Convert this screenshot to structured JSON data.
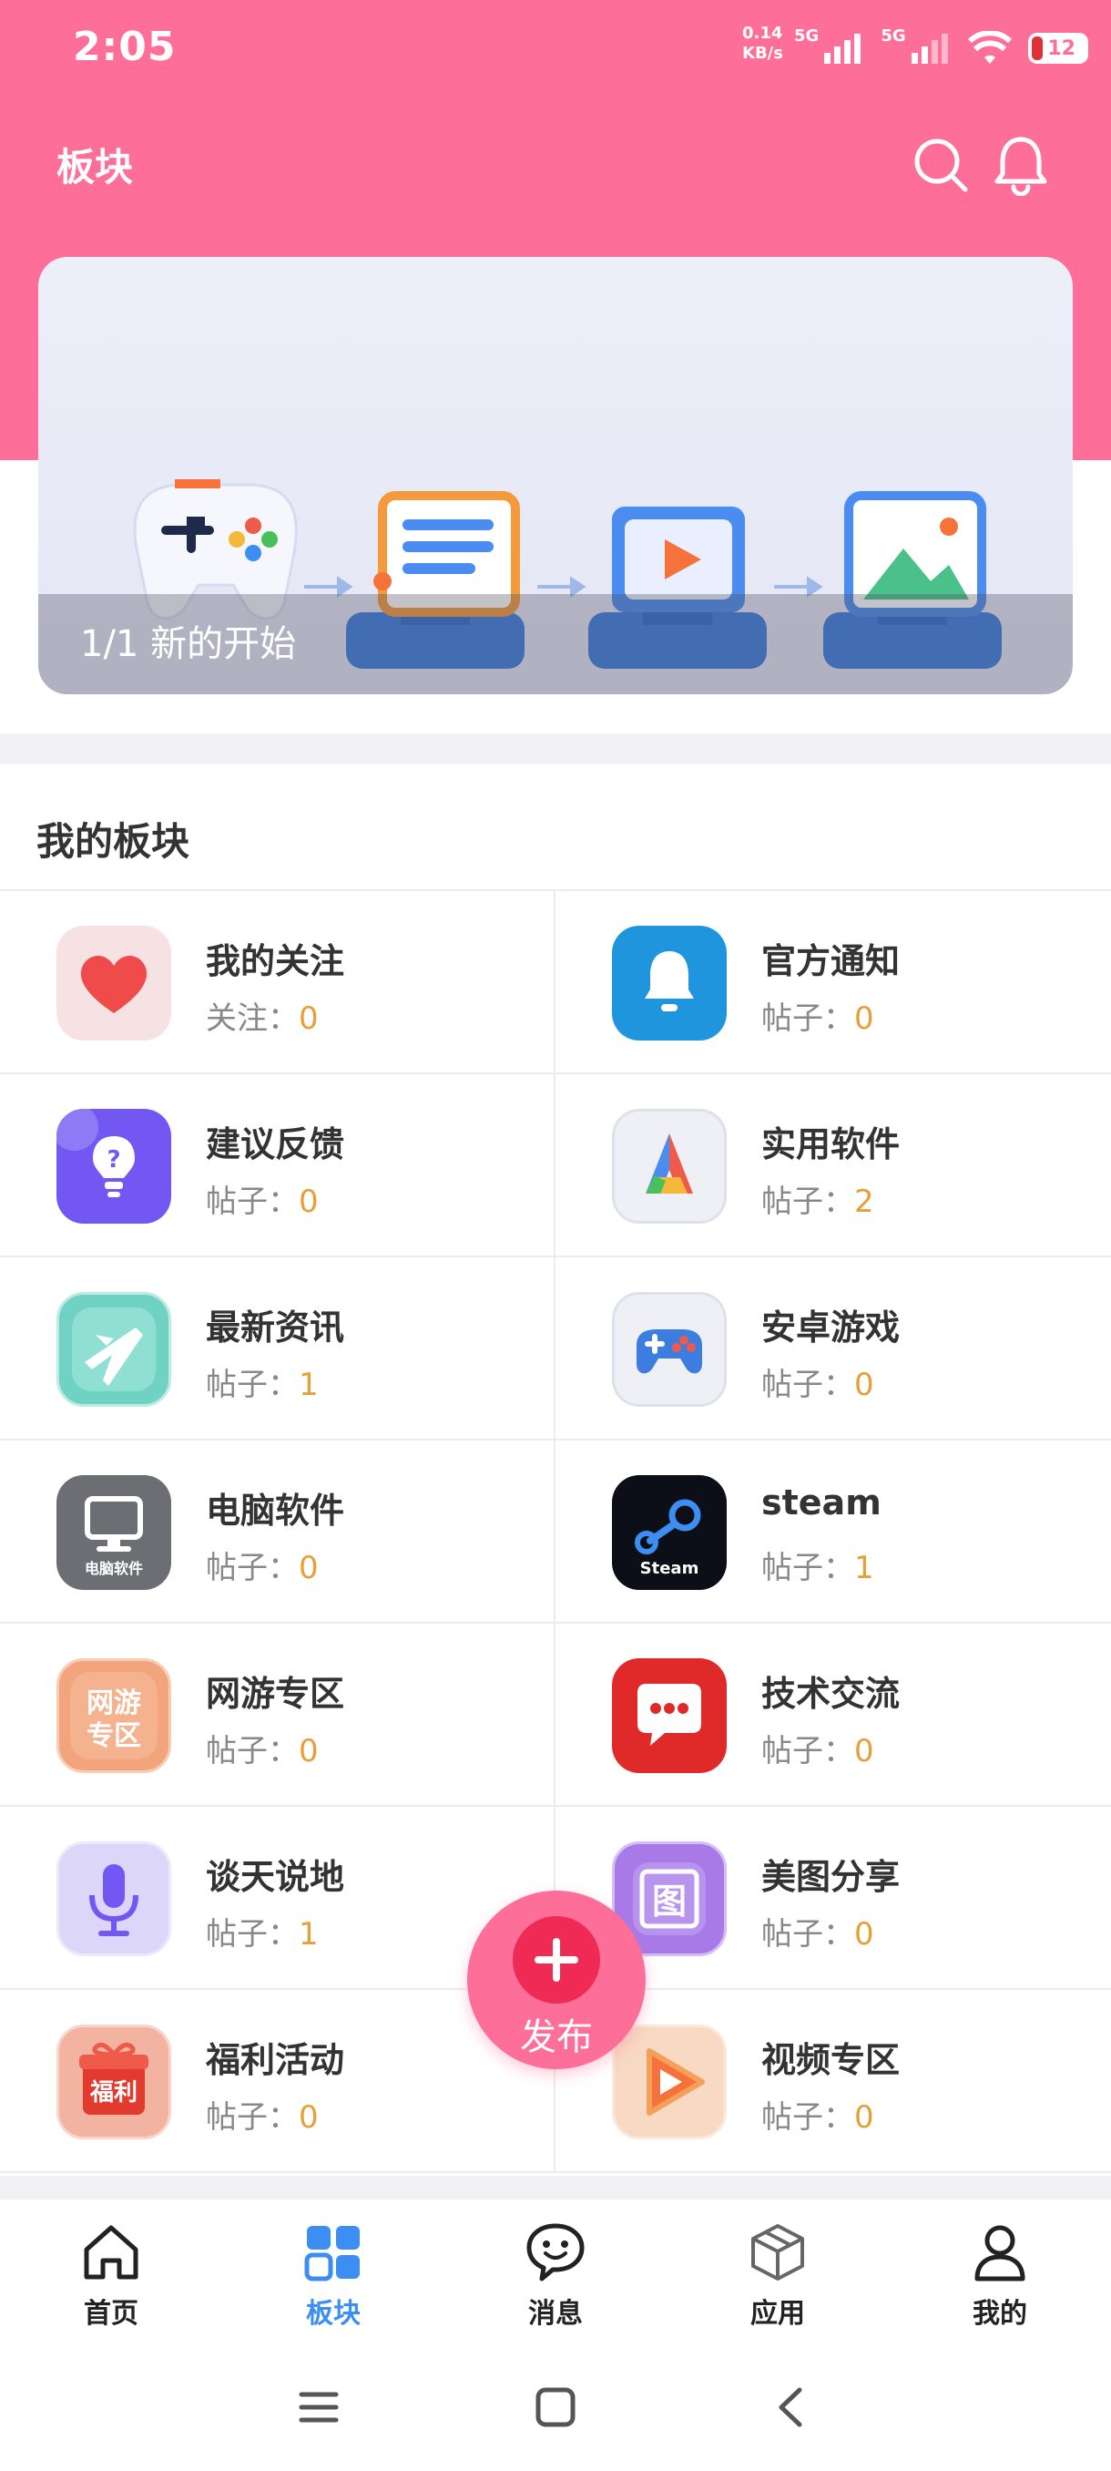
{
  "status_bar": {
    "time": "2:05",
    "speed_value": "0.14",
    "speed_unit": "KB/s",
    "network_1": "5G",
    "network_2": "5G",
    "battery": "12"
  },
  "header": {
    "title": "板块",
    "search_icon": "search-icon",
    "bell_icon": "bell-icon"
  },
  "banner": {
    "caption": "1/1 新的开始"
  },
  "section": {
    "title": "我的板块"
  },
  "boards": [
    {
      "name": "我的关注",
      "stat_label": "关注：",
      "stat_value": "0",
      "icon": "heart"
    },
    {
      "name": "官方通知",
      "stat_label": "帖子：",
      "stat_value": "0",
      "icon": "bell"
    },
    {
      "name": "建议反馈",
      "stat_label": "帖子：",
      "stat_value": "0",
      "icon": "bulb"
    },
    {
      "name": "实用软件",
      "stat_label": "帖子：",
      "stat_value": "2",
      "icon": "triangle-app"
    },
    {
      "name": "最新资讯",
      "stat_label": "帖子：",
      "stat_value": "1",
      "icon": "plane"
    },
    {
      "name": "安卓游戏",
      "stat_label": "帖子：",
      "stat_value": "0",
      "icon": "gamepad"
    },
    {
      "name": "电脑软件",
      "stat_label": "帖子：",
      "stat_value": "0",
      "icon": "monitor",
      "icon_text": "电脑软件"
    },
    {
      "name": "steam",
      "stat_label": "帖子：",
      "stat_value": "1",
      "icon": "steam",
      "icon_text": "Steam"
    },
    {
      "name": "网游专区",
      "stat_label": "帖子：",
      "stat_value": "0",
      "icon": "text-tile",
      "icon_text_1": "网游",
      "icon_text_2": "专区"
    },
    {
      "name": "技术交流",
      "stat_label": "帖子：",
      "stat_value": "0",
      "icon": "chat"
    },
    {
      "name": "谈天说地",
      "stat_label": "帖子：",
      "stat_value": "1",
      "icon": "microphone"
    },
    {
      "name": "美图分享",
      "stat_label": "帖子：",
      "stat_value": "0",
      "icon": "picture",
      "icon_text": "图"
    },
    {
      "name": "福利活动",
      "stat_label": "帖子：",
      "stat_value": "0",
      "icon": "gift",
      "icon_text": "福利"
    },
    {
      "name": "视频专区",
      "stat_label": "帖子：",
      "stat_value": "0",
      "icon": "play"
    }
  ],
  "fab": {
    "label": "发布",
    "icon": "plus-icon"
  },
  "bottom_nav": [
    {
      "label": "首页",
      "icon": "home-icon",
      "active": false
    },
    {
      "label": "板块",
      "icon": "grid-icon",
      "active": true
    },
    {
      "label": "消息",
      "icon": "chat-icon",
      "active": false
    },
    {
      "label": "应用",
      "icon": "cube-icon",
      "active": false
    },
    {
      "label": "我的",
      "icon": "person-icon",
      "active": false
    }
  ],
  "colors": {
    "brand_pink": "#fd6e99",
    "active_blue": "#3d8ef2",
    "count_orange": "#e6a03a"
  }
}
